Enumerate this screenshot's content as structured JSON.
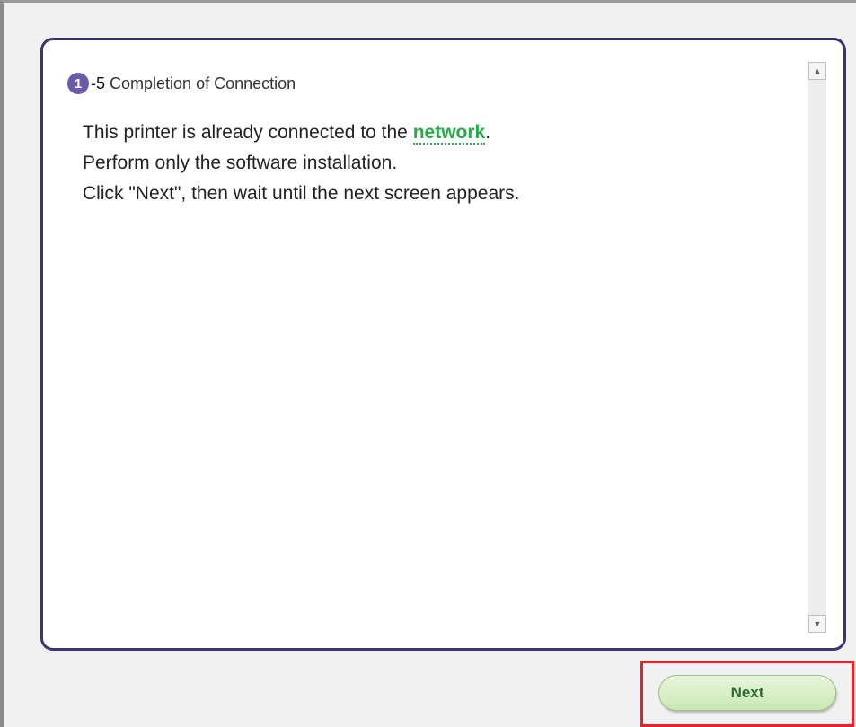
{
  "step": {
    "badge": "1",
    "number": "-5",
    "title": "Completion of Connection"
  },
  "body": {
    "line1_before": "This printer is already connected to the ",
    "link_text": "network",
    "line1_after": ".",
    "line2": "Perform only the software installation.",
    "line3": "Click \"Next\", then wait until the next screen appears."
  },
  "scrollbar": {
    "up_icon": "▲",
    "down_icon": "▼"
  },
  "buttons": {
    "next_label": "Next"
  },
  "colors": {
    "panel_border": "#3a3470",
    "badge": "#6a5aa8",
    "link": "#2aa84a",
    "highlight_box": "#e8202a",
    "button_fill": "#c9e8b3"
  }
}
